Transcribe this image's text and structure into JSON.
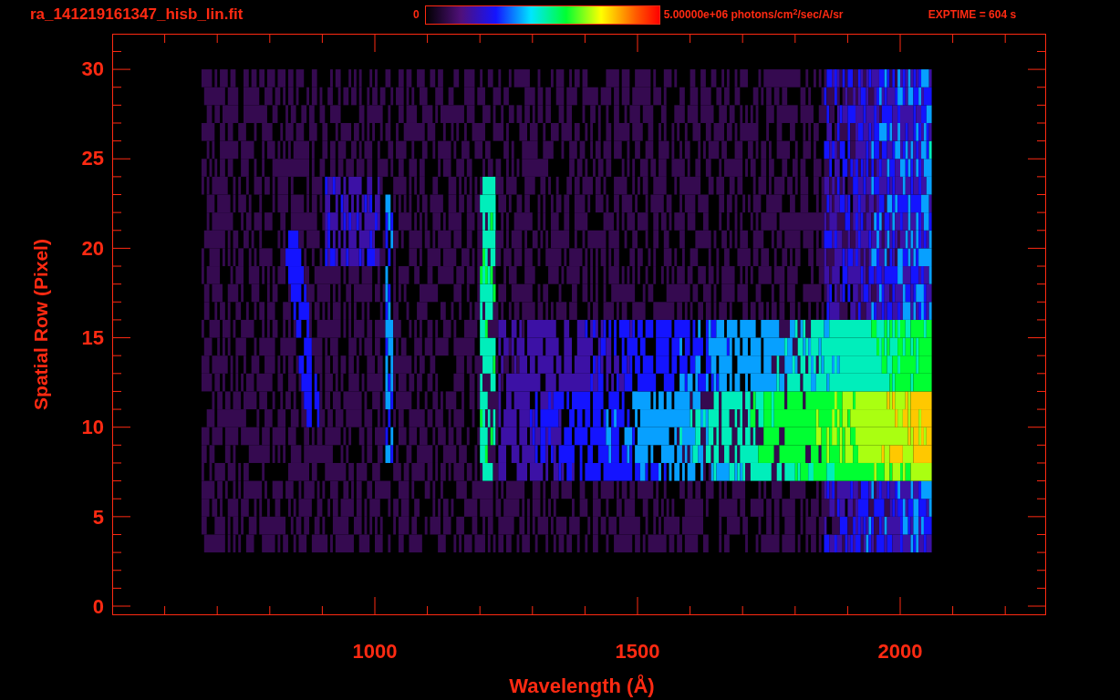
{
  "title": "ra_141219161347_hisb_lin.fit",
  "colorbar": {
    "min_label": "0",
    "max_label": "5.00000e+06 photons/cm$^{2}$/sec/A/sr"
  },
  "exposure": "EXPTIME = 604 s",
  "plot": {
    "y_axis": {
      "title": "Spatial Row (Pixel)",
      "ticks": [
        "30",
        "25",
        "20",
        "15",
        "10",
        "5",
        "0"
      ]
    },
    "x_axis": {
      "title": "Wavelength (Å)",
      "ticks": [
        "1000",
        "1500",
        "2000"
      ]
    }
  }
}
